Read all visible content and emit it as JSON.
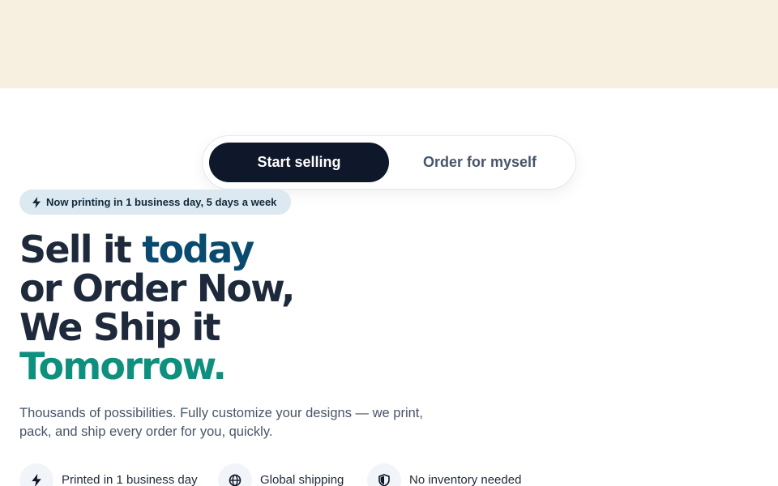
{
  "toggle": {
    "active_label": "Start selling",
    "inactive_label": "Order for myself"
  },
  "badge": {
    "icon": "bolt-icon",
    "text": "Now printing in 1 business day, 5 days a week"
  },
  "headline": {
    "line1_a": "Sell it ",
    "line1_b": "today",
    "line2": "or Order Now,",
    "line3": "We Ship it",
    "line4": "Tomorrow."
  },
  "subtext": "Thousands of possibilities. Fully customize your designs — we print, pack, and ship every order for you, quickly.",
  "features": [
    {
      "icon": "bolt-icon",
      "label": "Printed in 1 business day"
    },
    {
      "icon": "globe-icon",
      "label": "Global shipping"
    },
    {
      "icon": "shield-icon",
      "label": "No inventory needed"
    }
  ],
  "colors": {
    "top_band": "#f7efe0",
    "dark": "#0f172a",
    "accent_blue": "#0b4a6f",
    "accent_teal": "#0f8f7d",
    "badge_bg": "#dde9f1"
  }
}
